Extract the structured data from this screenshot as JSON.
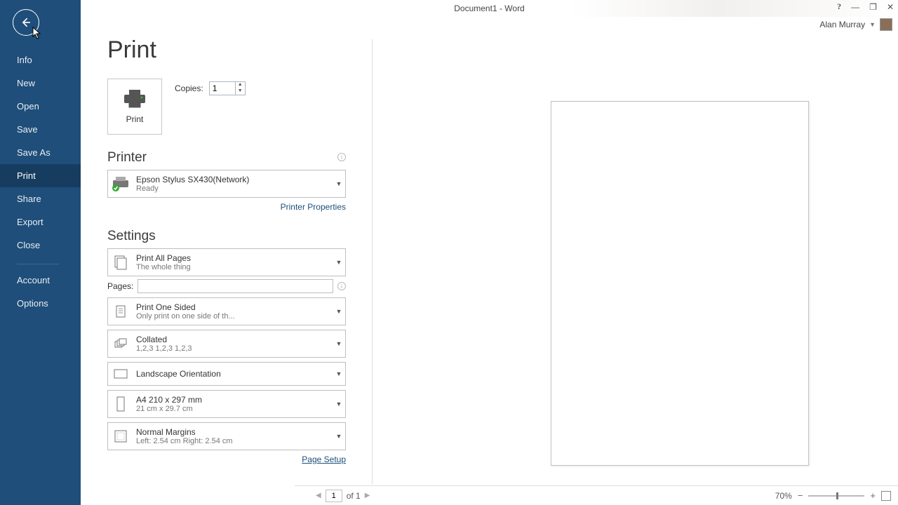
{
  "window": {
    "title": "Document1 - Word"
  },
  "user": {
    "name": "Alan Murray"
  },
  "sidebar": {
    "items": [
      {
        "label": "Info"
      },
      {
        "label": "New"
      },
      {
        "label": "Open"
      },
      {
        "label": "Save"
      },
      {
        "label": "Save As"
      },
      {
        "label": "Print"
      },
      {
        "label": "Share"
      },
      {
        "label": "Export"
      },
      {
        "label": "Close"
      }
    ],
    "bottom": [
      {
        "label": "Account"
      },
      {
        "label": "Options"
      }
    ]
  },
  "page": {
    "heading": "Print",
    "print_label": "Print",
    "copies_label": "Copies:",
    "copies_value": "1",
    "printer_heading": "Printer",
    "printer": {
      "name": "Epson Stylus SX430(Network)",
      "status": "Ready"
    },
    "printer_props": "Printer Properties",
    "settings_heading": "Settings",
    "settings": {
      "scope": {
        "title": "Print All Pages",
        "sub": "The whole thing"
      },
      "pages_label": "Pages:",
      "pages_value": "",
      "sided": {
        "title": "Print One Sided",
        "sub": "Only print on one side of th..."
      },
      "collate": {
        "title": "Collated",
        "sub": "1,2,3    1,2,3    1,2,3"
      },
      "orient": {
        "title": "Landscape Orientation"
      },
      "paper": {
        "title": "A4 210 x 297 mm",
        "sub": "21 cm x 29.7 cm"
      },
      "margins": {
        "title": "Normal Margins",
        "sub": "Left:  2.54 cm    Right:  2.54 cm"
      }
    },
    "page_setup": "Page Setup"
  },
  "status": {
    "page_current": "1",
    "page_of": "of 1",
    "zoom": "70%"
  }
}
